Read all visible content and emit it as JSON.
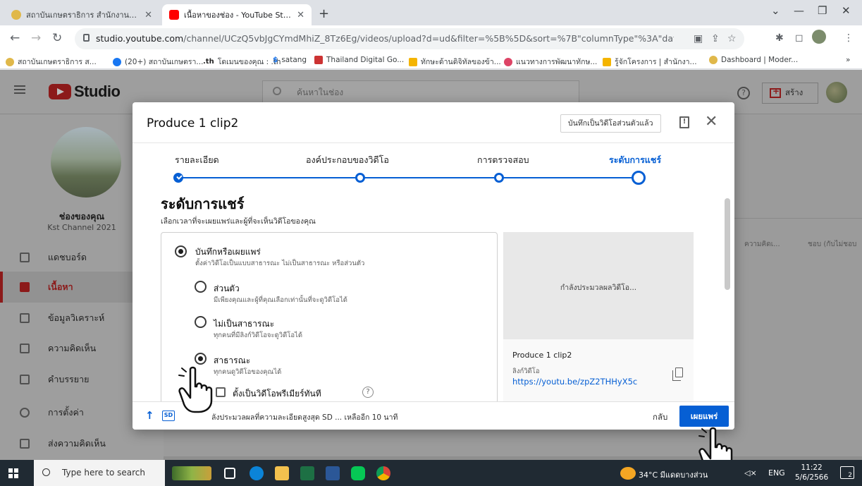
{
  "browser": {
    "tabs": [
      {
        "title": "สถาบันเกษตราธิการ สำนักงานปลัดกระ",
        "active": false
      },
      {
        "title": "เนื้อหาของช่อง - YouTube Studio",
        "active": true
      }
    ],
    "new_tab_label": "+",
    "url_domain": "studio.youtube.com",
    "url_path": "/channel/UCzQ5vbJgCYmdMhiZ_8Tz6Eg/videos/upload?d=ud&filter=%5B%5D&sort=%7B\"columnType\"%3A\"date\"%2C\"sortOrder\"%3A\"...",
    "bookmarks": [
      "สถาบันเกษตราธิการ ส...",
      "(20+) สถาบันเกษตรา...",
      "โดเมนของคุณ : .th",
      "satang",
      "Thailand Digital Go...",
      "ทักษะด้านดิจิทัลของข้า...",
      "แนวทางการพัฒนาทักษ...",
      "รู้จักโครงการ | สำนักงา...",
      "Dashboard | Moder..."
    ],
    "bookmark_more": "»"
  },
  "studio": {
    "logo_text": "Studio",
    "search_placeholder": "ค้นหาในช่อง",
    "create_label": "สร้าง",
    "channel_label": "ช่องของคุณ",
    "channel_name": "Kst Channel 2021",
    "nav": [
      {
        "label": "แดชบอร์ด",
        "active": false
      },
      {
        "label": "เนื้อหา",
        "active": true
      },
      {
        "label": "ข้อมูลวิเคราะห์",
        "active": false
      },
      {
        "label": "ความคิดเห็น",
        "active": false
      },
      {
        "label": "คำบรรยาย",
        "active": false
      },
      {
        "label": "การตั้งค่า",
        "active": false
      },
      {
        "label": "ส่งความคิดเห็น",
        "active": false
      }
    ],
    "bg_columns": [
      "ความคิดเ...",
      "ชอบ (กับไม่ชอบ"
    ]
  },
  "dialog": {
    "title": "Produce 1 clip2",
    "saved_status": "บันทึกเป็นวิดีโอส่วนตัวแล้ว",
    "steps": [
      {
        "label": "รายละเอียด",
        "state": "done"
      },
      {
        "label": "องค์ประกอบของวิดีโอ",
        "state": "pending"
      },
      {
        "label": "การตรวจสอบ",
        "state": "pending"
      },
      {
        "label": "ระดับการแชร์",
        "state": "current"
      }
    ],
    "visibility": {
      "heading": "ระดับการแชร์",
      "subheading": "เลือกเวลาที่จะเผยแพร่และผู้ที่จะเห็นวิดีโอของคุณ",
      "save_publish_label": "บันทึกหรือเผยแพร่",
      "save_publish_desc": "ตั้งค่าวิดีโอเป็นแบบสาธารณะ ไม่เป็นสาธารณะ หรือส่วนตัว",
      "options": [
        {
          "label": "ส่วนตัว",
          "desc": "มีเพียงคุณและผู้ที่คุณเลือกเท่านั้นที่จะดูวิดีโอได้",
          "selected": false
        },
        {
          "label": "ไม่เป็นสาธารณะ",
          "desc": "ทุกคนที่มีลิงก์วิดีโอจะดูวิดีโอได้",
          "selected": false
        },
        {
          "label": "สาธารณะ",
          "desc": "ทุกคนดูวิดีโอของคุณได้",
          "selected": true
        }
      ],
      "premiere_label": "ตั้งเป็นวิดีโอพรีเมียร์ทันที"
    },
    "preview": {
      "processing": "กำลังประมวลผลวิดีโอ...",
      "video_name": "Produce 1 clip2",
      "link_label": "ลิงก์วิดีโอ",
      "link_url": "https://youtu.be/zpZ2THHyX5c"
    },
    "footer": {
      "sd_badge": "SD",
      "status_text": "ลังประมวลผลที่ความละเอียดสูงสุด SD ... เหลืออีก 10 นาที",
      "back_label": "กลับ",
      "publish_label": "เผยแพร่"
    }
  },
  "taskbar": {
    "search_placeholder": "Type here to search",
    "weather": "34°C มีแดดบางส่วน",
    "language": "ENG",
    "time": "11:22",
    "date": "5/6/2566",
    "notif_count": "2"
  }
}
